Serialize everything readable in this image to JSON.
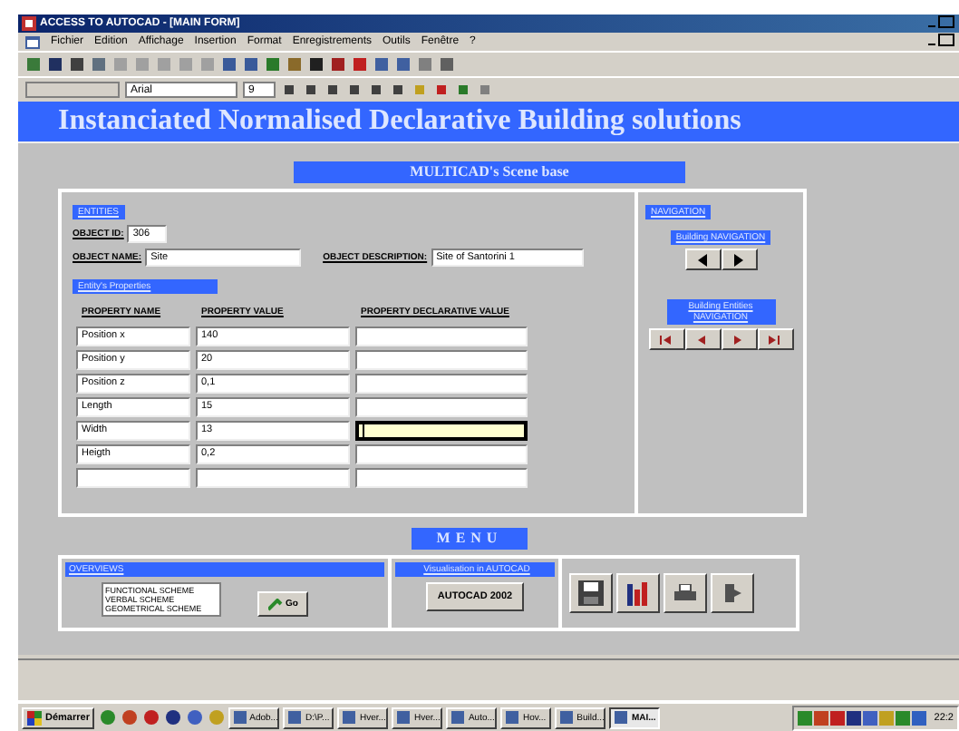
{
  "window": {
    "title": "ACCESS TO AUTOCAD - [MAIN FORM]"
  },
  "menu": [
    "Fichier",
    "Edition",
    "Affichage",
    "Insertion",
    "Format",
    "Enregistrements",
    "Outils",
    "Fenêtre",
    "?"
  ],
  "format_bar": {
    "font": "Arial",
    "size": "9"
  },
  "banner": "Instanciated Normalised Declarative Building solutions",
  "section_title": "MULTICAD's Scene base",
  "entities": {
    "label": "ENTITIES",
    "object_id": {
      "label": "OBJECT ID:",
      "value": "306"
    },
    "object_name": {
      "label": "OBJECT NAME:",
      "value": "Site"
    },
    "object_description": {
      "label": "OBJECT DESCRIPTION:",
      "value": "Site of Santorini 1"
    }
  },
  "properties": {
    "label": "Entity's Properties",
    "columns": [
      "PROPERTY NAME",
      "PROPERTY VALUE",
      "PROPERTY DECLARATIVE VALUE"
    ],
    "rows": [
      {
        "name": "Position x",
        "value": "140",
        "focused": false
      },
      {
        "name": "Position y",
        "value": "20",
        "focused": false
      },
      {
        "name": "Position z",
        "value": "0,1",
        "focused": false
      },
      {
        "name": "Length",
        "value": "15",
        "focused": false
      },
      {
        "name": "Width",
        "value": "13",
        "focused": true
      },
      {
        "name": "Heigth",
        "value": "0,2",
        "focused": false
      }
    ]
  },
  "navigation": {
    "label": "NAVIGATION",
    "building": "Building NAVIGATION",
    "entities": "Building Entities NAVIGATION"
  },
  "menu_title": "MENU",
  "overviews": {
    "label": "OVERVIEWS",
    "options": [
      "FUNCTIONAL SCHEME",
      "VERBAL SCHEME",
      "GEOMETRICAL SCHEME"
    ],
    "go": "Go"
  },
  "visualisation": {
    "label": "Visualisation in AUTOCAD",
    "button": "AUTOCAD 2002"
  },
  "taskbar": {
    "start": "Démarrer",
    "tasks": [
      {
        "label": "Adob...",
        "selected": false
      },
      {
        "label": "D:\\P...",
        "selected": false
      },
      {
        "label": "Hver...",
        "selected": false
      },
      {
        "label": "Hver...",
        "selected": false
      },
      {
        "label": "Auto...",
        "selected": false
      },
      {
        "label": "Hov...",
        "selected": false
      },
      {
        "label": "Build...",
        "selected": false
      },
      {
        "label": "MAI...",
        "selected": true
      }
    ],
    "clock": "22:2"
  }
}
